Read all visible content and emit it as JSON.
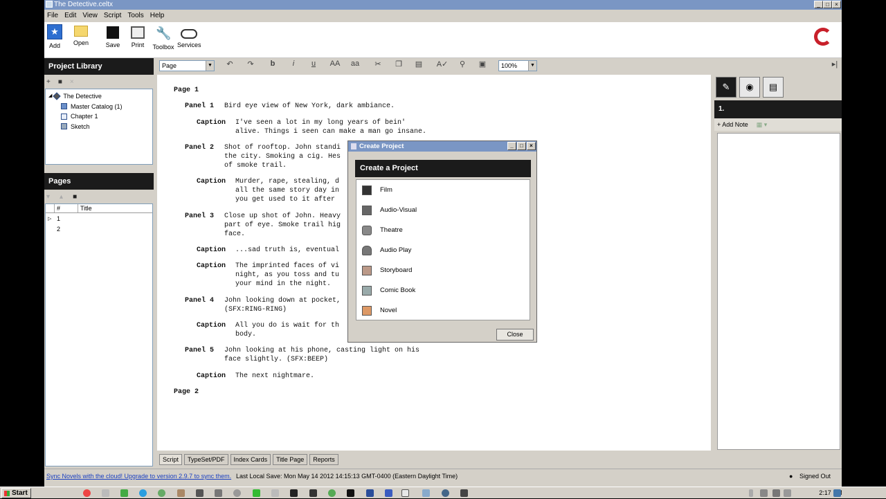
{
  "window": {
    "title": "The Detective.celtx"
  },
  "menu": [
    "File",
    "Edit",
    "View",
    "Script",
    "Tools",
    "Help"
  ],
  "toolbar": [
    {
      "label": "Add",
      "icon": "star-add-icon"
    },
    {
      "label": "Open",
      "icon": "folder-open-icon"
    },
    {
      "label": "Save",
      "icon": "disk-save-icon"
    },
    {
      "label": "Print",
      "icon": "printer-icon"
    },
    {
      "label": "Toolbox",
      "icon": "wrench-icon"
    },
    {
      "label": "Services",
      "icon": "cloud-icon"
    }
  ],
  "project_library": {
    "title": "Project Library",
    "tree": [
      {
        "label": "The Detective",
        "icon": "project-icon"
      },
      {
        "label": "Master Catalog (1)",
        "icon": "catalog-icon"
      },
      {
        "label": "Chapter 1",
        "icon": "chapter-icon"
      },
      {
        "label": "Sketch",
        "icon": "sketch-icon"
      }
    ]
  },
  "pages": {
    "title": "Pages",
    "columns": [
      "#",
      "Title"
    ],
    "rows": [
      "1",
      "2"
    ]
  },
  "format": {
    "element": "Page",
    "zoom": "100%",
    "buttons": [
      "b",
      "i",
      "u",
      "AA",
      "aa"
    ]
  },
  "script": [
    {
      "label": "Page 1",
      "text": ""
    },
    {
      "label": "Panel 1",
      "text": "Bird eye view of New York, dark ambiance."
    },
    {
      "label": "Caption",
      "text": "I've seen a lot in my long years of bein'\nalive. Things i seen can make a man go insane."
    },
    {
      "label": "Panel 2",
      "text": "Shot of rooftop. John standi\nthe city. Smoking a cig. Hes\nof smoke trail."
    },
    {
      "label": "Caption",
      "text": "Murder, rape, stealing, d\nall the same story day in\nyou get used to it after"
    },
    {
      "label": "Panel 3",
      "text": "Close up shot of John. Heavy\npart of eye. Smoke trail hig\nface."
    },
    {
      "label": "Caption",
      "text": "...sad truth is, eventual"
    },
    {
      "label": "Caption",
      "text": "The imprinted faces of vi\nnight, as you toss and tu\nyour mind in the night."
    },
    {
      "label": "Panel 4",
      "text": "John looking down at pocket,\n(SFX:RING-RING)"
    },
    {
      "label": "Caption",
      "text": "All you do is wait for th\nbody."
    },
    {
      "label": "Panel 5",
      "text": "John looking at his phone, casting light on his\nface slightly. (SFX:BEEP)"
    },
    {
      "label": "Caption",
      "text": "The next nightmare."
    },
    {
      "label": "Page 2",
      "text": ""
    }
  ],
  "bottom_tabs": [
    "Script",
    "TypeSet/PDF",
    "Index Cards",
    "Title Page",
    "Reports"
  ],
  "right_panel": {
    "header": "1.",
    "add_note": "Add Note"
  },
  "status": {
    "sync_link": "Sync Novels with the cloud! Upgrade to version 2.9.7 to sync them.",
    "last_save": "Last Local Save: Mon May 14 2012 14:15:13 GMT-0400 (Eastern Daylight Time)",
    "signed": "Signed Out"
  },
  "dialog": {
    "title": "Create Project",
    "heading": "Create a Project",
    "items": [
      {
        "label": "Film",
        "icon": "clapperboard-icon"
      },
      {
        "label": "Audio-Visual",
        "icon": "camera-icon"
      },
      {
        "label": "Theatre",
        "icon": "mask-icon"
      },
      {
        "label": "Audio Play",
        "icon": "microphone-icon"
      },
      {
        "label": "Storyboard",
        "icon": "storyboard-icon"
      },
      {
        "label": "Comic Book",
        "icon": "comic-icon"
      },
      {
        "label": "Novel",
        "icon": "book-icon"
      }
    ],
    "close": "Close"
  },
  "taskbar": {
    "start": "Start",
    "clock": "2:17 PM"
  }
}
